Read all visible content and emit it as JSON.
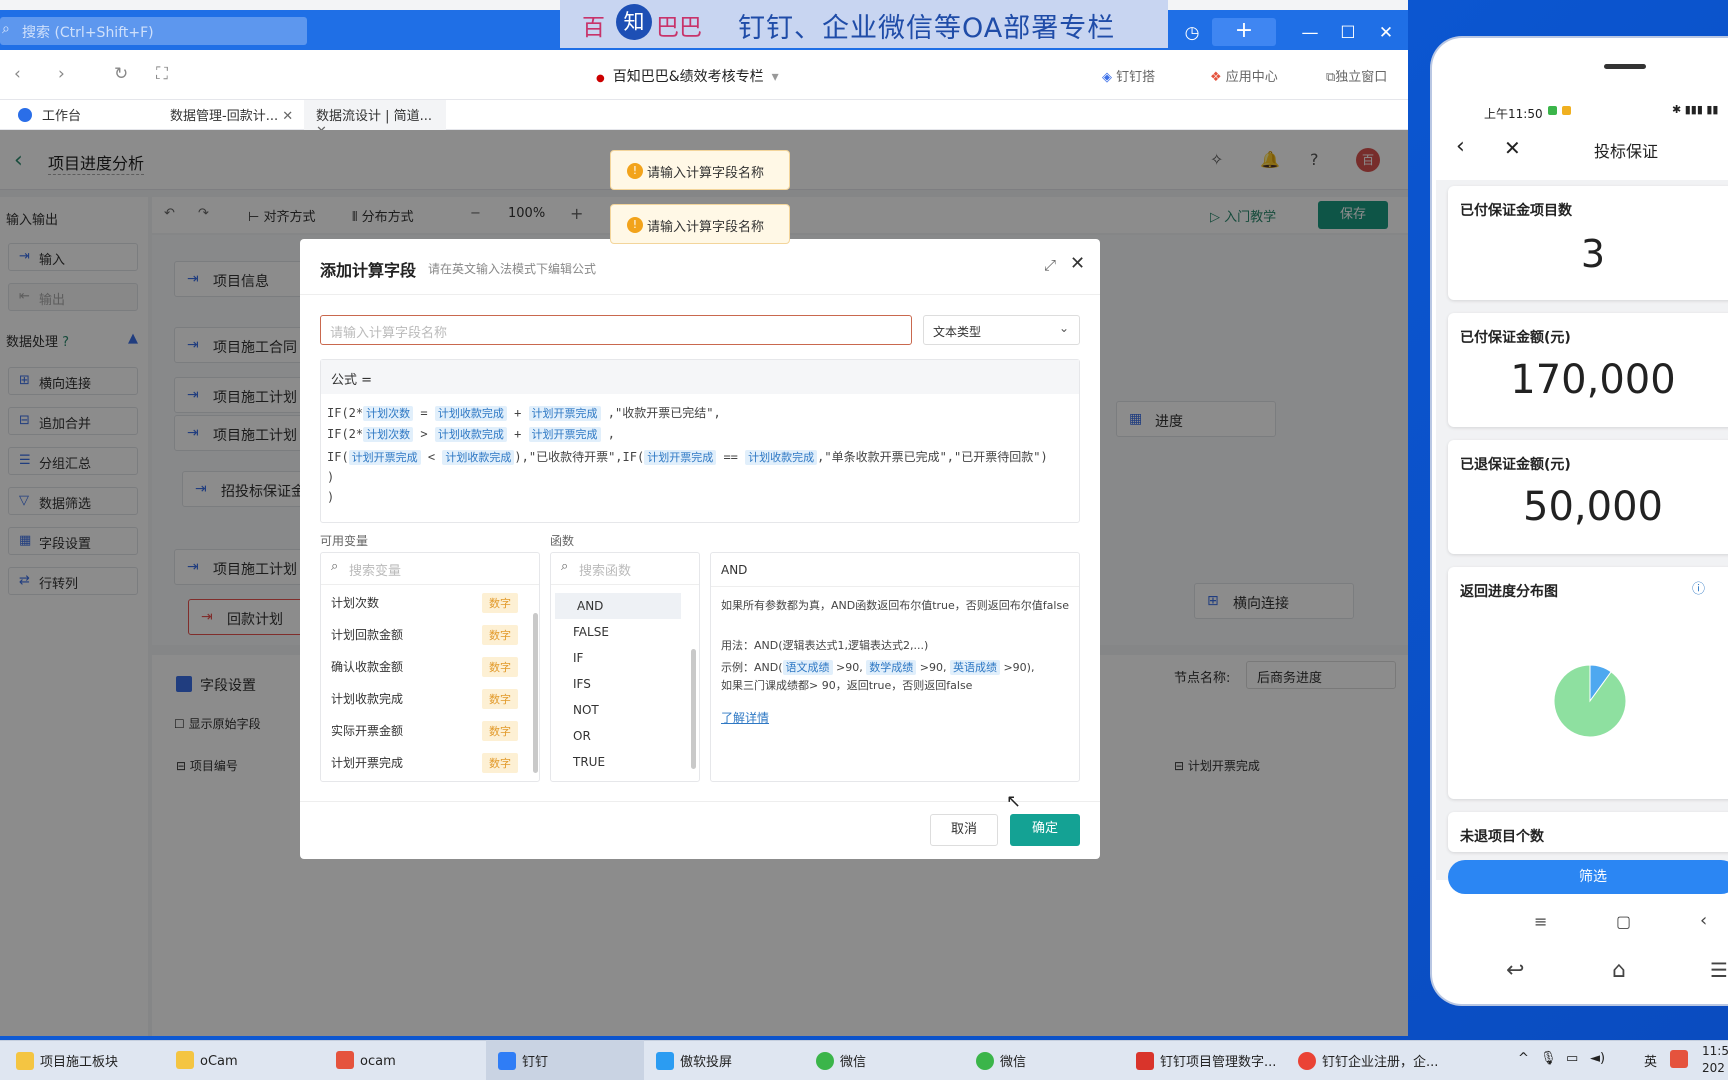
{
  "window": {
    "search_placeholder": "搜索 (Ctrl+Shift+F)",
    "title": "百知巴巴&绩效考核专栏",
    "banner": {
      "part1": "百",
      "part2": "知",
      "part3": "巴巴",
      "part4": "钉钉、企业微信等OA部署专栏"
    },
    "header_links": [
      "钉钉搭",
      "应用中心",
      "独立窗口"
    ]
  },
  "tabs": [
    "工作台",
    "数据管理-回款计...",
    "数据流设计 | 简道..."
  ],
  "page": {
    "title": "项目进度分析",
    "toolbar": {
      "align": "对齐方式",
      "distribute": "分布方式",
      "zoom": "100%",
      "tutorial": "入门教学",
      "save": "保存"
    }
  },
  "left_panel": {
    "section_io": "输入输出",
    "input": "输入",
    "output": "输出",
    "section_process": "数据处理",
    "items": [
      "横向连接",
      "追加合并",
      "分组汇总",
      "数据筛选",
      "字段设置",
      "行转列"
    ]
  },
  "canvas": {
    "nodes": [
      "项目信息",
      "项目施工合同",
      "项目施工计划",
      "项目施工计划",
      "招投标保证金",
      "项目施工计划",
      "回款计划",
      "进度",
      "横向连接"
    ]
  },
  "bottom": {
    "field_settings": "字段设置",
    "show_original": "显示原始字段",
    "node_name_label": "节点名称:",
    "node_name_value": "后商务进度",
    "col_left": "项目编号",
    "col_right": "计划开票完成"
  },
  "toasts": [
    "请输入计算字段名称",
    "请输入计算字段名称"
  ],
  "dialog": {
    "title": "添加计算字段",
    "subtitle": "请在英文输入法模式下编辑公式",
    "name_placeholder": "请输入计算字段名称",
    "type_value": "文本类型",
    "formula_label": "公式 =",
    "vars_title": "可用变量",
    "vars_search": "搜索变量",
    "variables": [
      {
        "name": "计划次数",
        "type": "数字"
      },
      {
        "name": "计划回款金额",
        "type": "数字"
      },
      {
        "name": "确认收款金额",
        "type": "数字"
      },
      {
        "name": "计划收款完成",
        "type": "数字"
      },
      {
        "name": "实际开票金额",
        "type": "数字"
      },
      {
        "name": "计划开票完成",
        "type": "数字"
      }
    ],
    "funcs_title": "函数",
    "funcs_search": "搜索函数",
    "functions": [
      "AND",
      "FALSE",
      "IF",
      "IFS",
      "NOT",
      "OR",
      "TRUE"
    ],
    "help": {
      "name": "AND",
      "desc": "如果所有参数都为真，AND函数返回布尔值true，否则返回布尔值false",
      "usage": "用法：AND(逻辑表达式1,逻辑表达式2,...)",
      "example_prefix": "示例：AND(",
      "ex_var1": "语文成绩",
      "ex_mid1": ">90,",
      "ex_var2": "数学成绩",
      "ex_mid2": ">90,",
      "ex_var3": "英语成绩",
      "ex_suffix": ">90),",
      "example_note": "如果三门课成绩都> 90，返回true，否则返回false",
      "more": "了解详情"
    },
    "cancel": "取消",
    "ok": "确定"
  },
  "formula": {
    "l1_a": "IF(2*",
    "l1_v1": "计划次数",
    "l1_op1": "=",
    "l1_v2": "计划收款完成",
    "l1_op2": "+",
    "l1_v3": "计划开票完成",
    "l1_s": ",\"收款开票已完结\",",
    "l2_a": "IF(2*",
    "l2_v1": "计划次数",
    "l2_op1": ">",
    "l2_v2": "计划收款完成",
    "l2_op2": "+",
    "l2_v3": "计划开票完成",
    "l2_s": ",",
    "l3_a": "IF(",
    "l3_v1": "计划开票完成",
    "l3_op1": "<",
    "l3_v2": "计划收款完成",
    "l3_s1": "),\"已收款待开票\",IF(",
    "l3_v3": "计划开票完成",
    "l3_op2": "==",
    "l3_v4": "计划收款完成",
    "l3_s2": ",\"单条收款开票已完成\",\"已开票待回款\")",
    "l4": ")",
    "l5": ")"
  },
  "phone": {
    "status_time": "上午11:50",
    "title": "投标保证",
    "cards": [
      {
        "label": "已付保证金项目数",
        "value": "3"
      },
      {
        "label": "已付保证金额(元)",
        "value": "170,000"
      },
      {
        "label": "已退保证金额(元)",
        "value": "50,000"
      }
    ],
    "chart_title": "返回进度分布图",
    "next_label": "未退项目个数",
    "filter_button": "筛选"
  },
  "chart_data": {
    "type": "pie",
    "title": "返回进度分布图",
    "values": [
      0.9,
      0.1
    ],
    "colors": [
      "#8ee0a0",
      "#4ea8f0"
    ]
  },
  "taskbar": {
    "items": [
      "项目施工板块",
      "oCam",
      "ocam",
      "钉钉",
      "傲软投屏",
      "微信",
      "微信",
      "钉钉项目管理数字...",
      "钉钉企业注册，企..."
    ],
    "ime": "英",
    "time": "11:5",
    "date": "202"
  }
}
